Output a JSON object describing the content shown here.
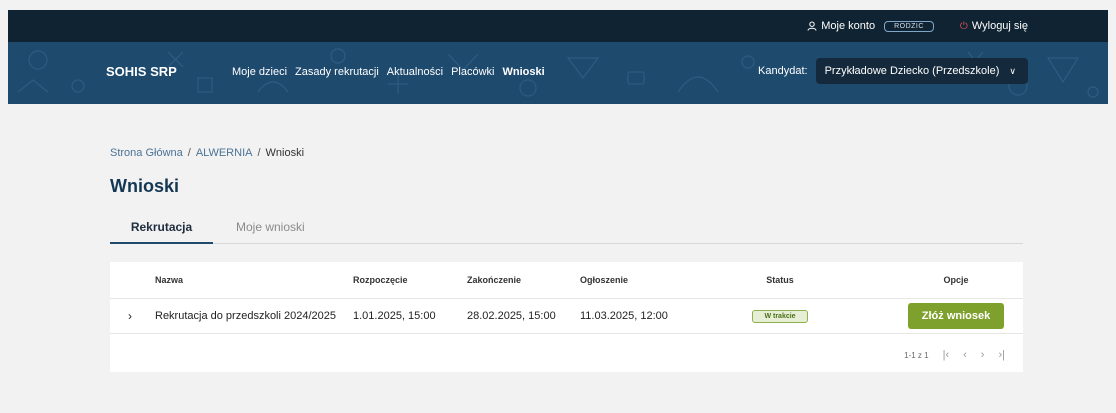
{
  "topbar": {
    "account_label": "Moje konto",
    "role_badge": "RODZIC",
    "logout_label": "Wyloguj się"
  },
  "navbar": {
    "brand": "SOHIS SRP",
    "items": [
      {
        "label": "Moje dzieci"
      },
      {
        "label": "Zasady rekrutacji"
      },
      {
        "label": "Aktualności"
      },
      {
        "label": "Placówki"
      },
      {
        "label": "Wnioski"
      }
    ],
    "active": "Wnioski",
    "candidate_label": "Kandydat:",
    "candidate_value": "Przykładowe Dziecko (Przedszkole)"
  },
  "breadcrumb": {
    "items": [
      "Strona Główna",
      "ALWERNIA",
      "Wnioski"
    ],
    "separator": "/"
  },
  "page_title": "Wnioski",
  "tabs": [
    {
      "label": "Rekrutacja",
      "active": true
    },
    {
      "label": "Moje wnioski",
      "active": false
    }
  ],
  "table": {
    "columns": [
      "Nazwa",
      "Rozpoczęcie",
      "Zakończenie",
      "Ogłoszenie",
      "Status",
      "Opcje"
    ],
    "rows": [
      {
        "name": "Rekrutacja do przedszkoli 2024/2025",
        "start": "1.01.2025, 15:00",
        "end": "28.02.2025, 15:00",
        "announcement": "11.03.2025, 12:00",
        "status": "W trakcie",
        "action": "Złóż wniosek"
      }
    ]
  },
  "pagination": {
    "range": "1-1 z 1"
  },
  "colors": {
    "topbar": "#0f2332",
    "navbar": "#1e4a6e",
    "primary": "#143853",
    "action_green": "#7ea02c",
    "status_green": "#8fb04a",
    "logout_red": "#e25555"
  },
  "icons": {
    "account": "user-icon",
    "logout": "power-icon",
    "candidate_dropdown": "chevron-down-icon",
    "row_expand": "chevron-right-icon",
    "pager": [
      "first-page-icon",
      "prev-page-icon",
      "next-page-icon",
      "last-page-icon"
    ]
  }
}
